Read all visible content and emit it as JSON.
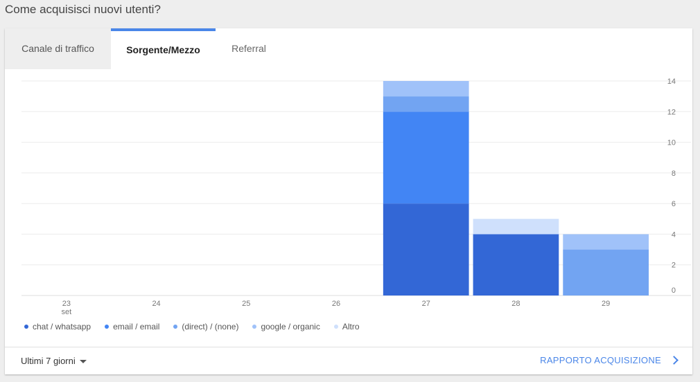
{
  "page": {
    "title": "Come acquisisci nuovi utenti?"
  },
  "tabs": [
    {
      "label": "Canale di traffico",
      "active": false
    },
    {
      "label": "Sorgente/Mezzo",
      "active": true
    },
    {
      "label": "Referral",
      "active": false
    }
  ],
  "footer": {
    "range_label": "Ultimi 7 giorni",
    "report_label": "RAPPORTO ACQUISIZIONE"
  },
  "chart_data": {
    "type": "bar",
    "stacked": true,
    "categories": [
      "23",
      "24",
      "25",
      "26",
      "27",
      "28",
      "29"
    ],
    "category_sublabels": [
      "set",
      "",
      "",
      "",
      "",
      "",
      ""
    ],
    "series": [
      {
        "name": "chat / whatsapp",
        "color": "#3367d6",
        "values": [
          0,
          0,
          0,
          0,
          6,
          4,
          0
        ]
      },
      {
        "name": "email / email",
        "color": "#4285f4",
        "values": [
          0,
          0,
          0,
          0,
          6,
          0,
          0
        ]
      },
      {
        "name": "(direct) / (none)",
        "color": "#72a4f2",
        "values": [
          0,
          0,
          0,
          0,
          1,
          0,
          3
        ]
      },
      {
        "name": "google / organic",
        "color": "#a0c2f9",
        "values": [
          0,
          0,
          0,
          0,
          1,
          0,
          1
        ]
      },
      {
        "name": "Altro",
        "color": "#cfe0fc",
        "values": [
          0,
          0,
          0,
          0,
          0,
          1,
          0
        ]
      }
    ],
    "yticks": [
      0,
      2,
      4,
      6,
      8,
      10,
      12,
      14
    ],
    "ylim": [
      0,
      14
    ],
    "y_axis_position": "right",
    "grid": true,
    "legend_position": "bottom-left"
  }
}
